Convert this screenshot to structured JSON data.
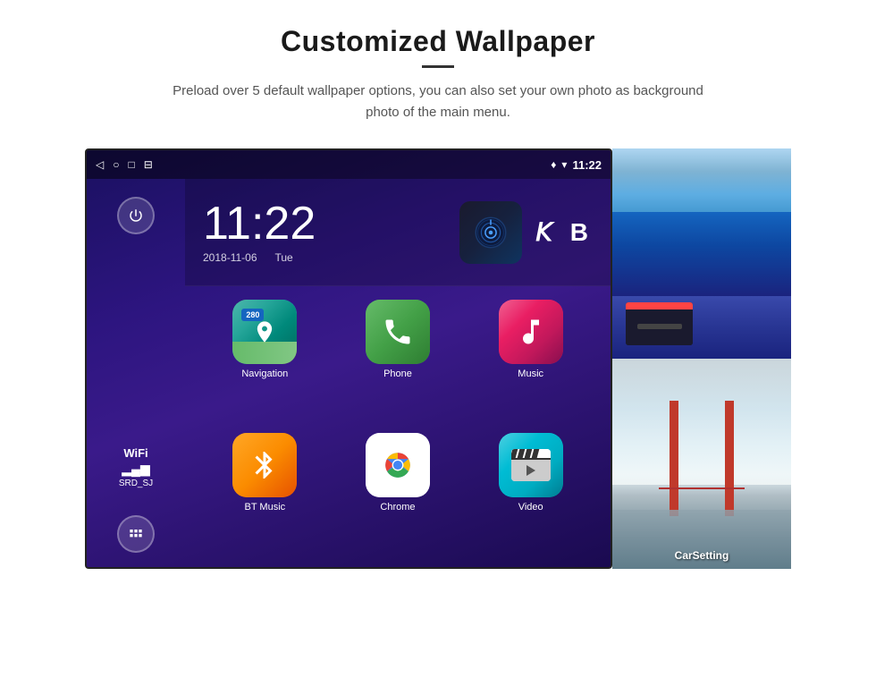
{
  "header": {
    "title": "Customized Wallpaper",
    "subtitle": "Preload over 5 default wallpaper options, you can also set your own photo as background photo of the main menu."
  },
  "status_bar": {
    "time": "11:22",
    "nav_back": "◁",
    "nav_home": "○",
    "nav_square": "□",
    "nav_photo": "⊟",
    "location_icon": "♦",
    "wifi_icon": "▾"
  },
  "clock": {
    "time": "11:22",
    "date": "2018-11-06",
    "day": "Tue"
  },
  "wifi": {
    "label": "WiFi",
    "ssid": "SRD_SJ"
  },
  "apps": [
    {
      "name": "Navigation",
      "type": "navigation"
    },
    {
      "name": "Phone",
      "type": "phone"
    },
    {
      "name": "Music",
      "type": "music"
    },
    {
      "name": "BT Music",
      "type": "btmusic"
    },
    {
      "name": "Chrome",
      "type": "chrome"
    },
    {
      "name": "Video",
      "type": "video"
    }
  ],
  "wallpapers": [
    {
      "name": "ice-cave",
      "label": ""
    },
    {
      "name": "bridge",
      "label": "CarSetting"
    }
  ]
}
